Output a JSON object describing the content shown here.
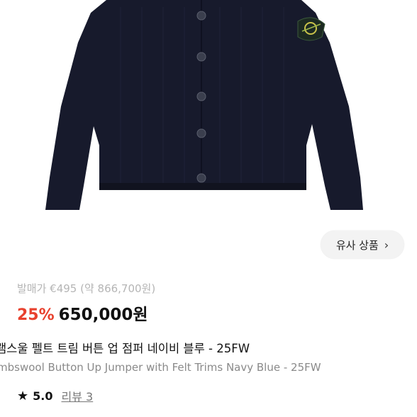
{
  "similar_button": {
    "label": "유사 상품",
    "icon": "chevron-right-icon"
  },
  "pricing": {
    "retail_label": "발매가 €495 (약 866,700원)",
    "discount": "25%",
    "price": "650,000원"
  },
  "product": {
    "name_ko": "램스울 펠트 트림 버튼 업 점퍼 네이비 블루 - 25FW",
    "name_en": "mbswool Button Up Jumper with Felt Trims Navy Blue - 25FW"
  },
  "rating": {
    "icon": "star-icon",
    "score": "5.0",
    "reviews_label": "리뷰 3"
  },
  "colors": {
    "discount": "#e8412e",
    "garment": "#171a2c"
  }
}
